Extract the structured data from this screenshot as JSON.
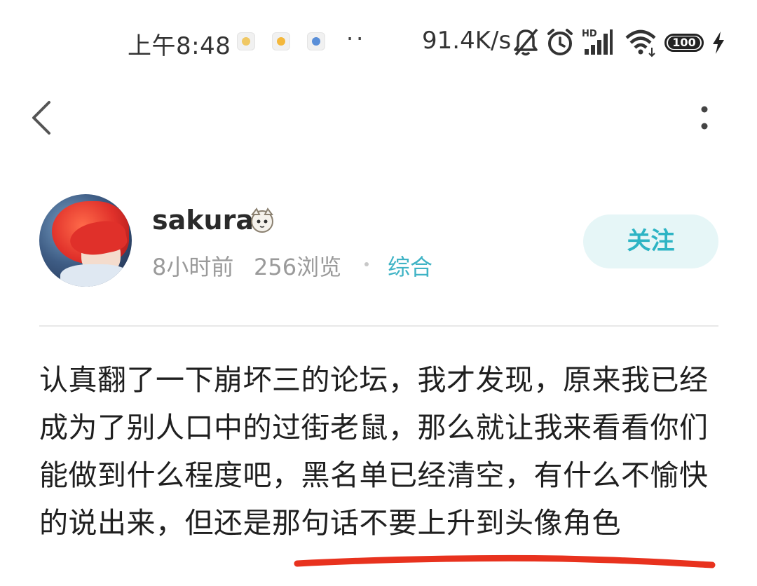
{
  "status_bar": {
    "time": "上午8:48",
    "notification_dots": "··",
    "net_speed": "91.4K/s",
    "hd_label": "HD",
    "battery": "100",
    "icons": [
      "app-notification-icon",
      "app-notification-icon",
      "app-notification-icon",
      "mute-bell-icon",
      "alarm-icon",
      "hd-signal-icon",
      "wifi-icon",
      "battery-icon",
      "charging-icon"
    ]
  },
  "nav": {
    "back_icon": "chevron-left-icon",
    "more_icon": "more-vertical-icon"
  },
  "post": {
    "author": {
      "name": "sakura",
      "time": "8小时前",
      "views": "256浏览",
      "category": "综合"
    },
    "follow_label": "关注",
    "content": "认真翻了一下崩坏三的论坛，我才发现，原来我已经成为了别人口中的过街老鼠，那么就让我来看看你们能做到什么程度吧，黑名单已经清空，有什么不愉快的说出来，但还是那句话不要上升到头像角色"
  },
  "colors": {
    "accent": "#3fb3c5",
    "follow_bg": "#e6f6f7",
    "annotation_red": "#e8321e"
  }
}
